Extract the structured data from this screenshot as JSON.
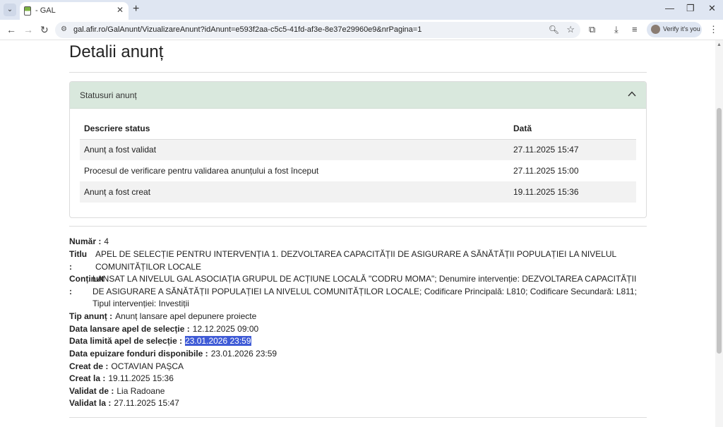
{
  "browser": {
    "tab_title": "- GAL",
    "url": "gal.afir.ro/GalAnunt/VizualizareAnunt?idAnunt=e593f2aa-c5c5-41fd-af3e-8e37e29960e9&nrPagina=1",
    "verify_label": "Verify it's you"
  },
  "page": {
    "title": "Detalii anunț"
  },
  "statuses": {
    "header": "Statusuri anunț",
    "columns": {
      "description": "Descriere status",
      "date": "Dată"
    },
    "rows": [
      {
        "description": "Anunț a fost validat",
        "date": "27.11.2025 15:47"
      },
      {
        "description": "Procesul de verificare pentru validarea anunțului a fost început",
        "date": "27.11.2025 15:00"
      },
      {
        "description": "Anunț a fost creat",
        "date": "19.11.2025 15:36"
      }
    ]
  },
  "details": {
    "numar_label": "Număr :",
    "numar": "4",
    "titlu_label": "Titlu :",
    "titlu": "APEL DE SELECȚIE PENTRU INTERVENȚIA 1. DEZVOLTAREA CAPACITĂȚII DE ASIGURARE A SĂNĂTĂȚII POPULAȚIEI LA NIVELUL COMUNITĂȚILOR LOCALE",
    "continut_label": "Conținut :",
    "continut": "LANSAT LA NIVELUL GAL ASOCIAȚIA GRUPUL DE ACȚIUNE LOCALĂ \"CODRU MOMA\"; Denumire intervenție: DEZVOLTAREA CAPACITĂȚII DE ASIGURARE A SĂNĂTĂȚII POPULAȚIEI LA NIVELUL COMUNITĂȚILOR LOCALE; Codificare Principală: L810; Codificare Secundară: L811; Tipul intervenției: Investiții",
    "tip_label": "Tip anunț :",
    "tip": "Anunț lansare apel depunere proiecte",
    "data_lansare_label": "Data lansare apel de selecție :",
    "data_lansare": "12.12.2025 09:00",
    "data_limita_label": "Data limită apel de selecție :",
    "data_limita": "23.01.2026 23:59",
    "data_epuizare_label": "Data epuizare fonduri disponibile :",
    "data_epuizare": "23.01.2026 23:59",
    "creat_de_label": "Creat de :",
    "creat_de": "OCTAVIAN PAȘCA",
    "creat_la_label": "Creat la :",
    "creat_la": "19.11.2025 15:36",
    "validat_de_label": "Validat de :",
    "validat_de": "Lia Radoane",
    "validat_la_label": "Validat la :",
    "validat_la": "27.11.2025 15:47"
  }
}
